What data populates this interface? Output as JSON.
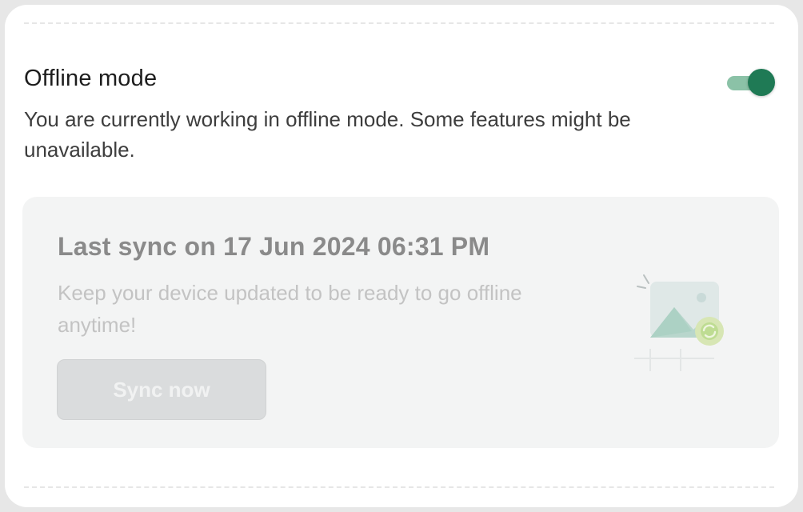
{
  "offline": {
    "title": "Offline mode",
    "description": "You are currently working in offline mode. Some features might be unavailable.",
    "toggle_on": true
  },
  "sync": {
    "title": "Last sync on 17 Jun 2024 06:31 PM",
    "description": "Keep your device updated to be ready to go offline anytime!",
    "button_label": "Sync now",
    "button_enabled": false,
    "illustration_icon": "image-sync-icon"
  },
  "colors": {
    "toggle_knob": "#1f7a55",
    "toggle_track": "#8bc2a7",
    "panel_bg": "#f3f4f4",
    "button_bg": "#dadcdd"
  }
}
